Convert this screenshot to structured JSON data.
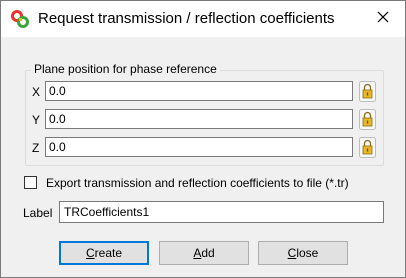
{
  "window": {
    "title": "Request transmission / reflection coefficients",
    "app_icon": "cst-app-icon",
    "close_icon": "close-icon"
  },
  "phase_reference": {
    "group_title": "Plane position for phase reference",
    "fields": [
      {
        "label": "X",
        "value": "0.0"
      },
      {
        "label": "Y",
        "value": "0.0"
      },
      {
        "label": "Z",
        "value": "0.0"
      }
    ],
    "lock_icon": "lock-icon"
  },
  "export": {
    "checked": false,
    "label": "Export transmission and reflection coefficients to file (*.tr)"
  },
  "name": {
    "label": "Label",
    "value": "TRCoefficients1"
  },
  "buttons": {
    "create_first": "C",
    "create_rest": "reate",
    "add_first": "A",
    "add_rest": "dd",
    "close_first": "C",
    "close_rest": "lose"
  },
  "colors": {
    "default_button_border": "#0078d7",
    "title_bar": "#ffffff",
    "dialog_bg": "#f0f0f0"
  }
}
